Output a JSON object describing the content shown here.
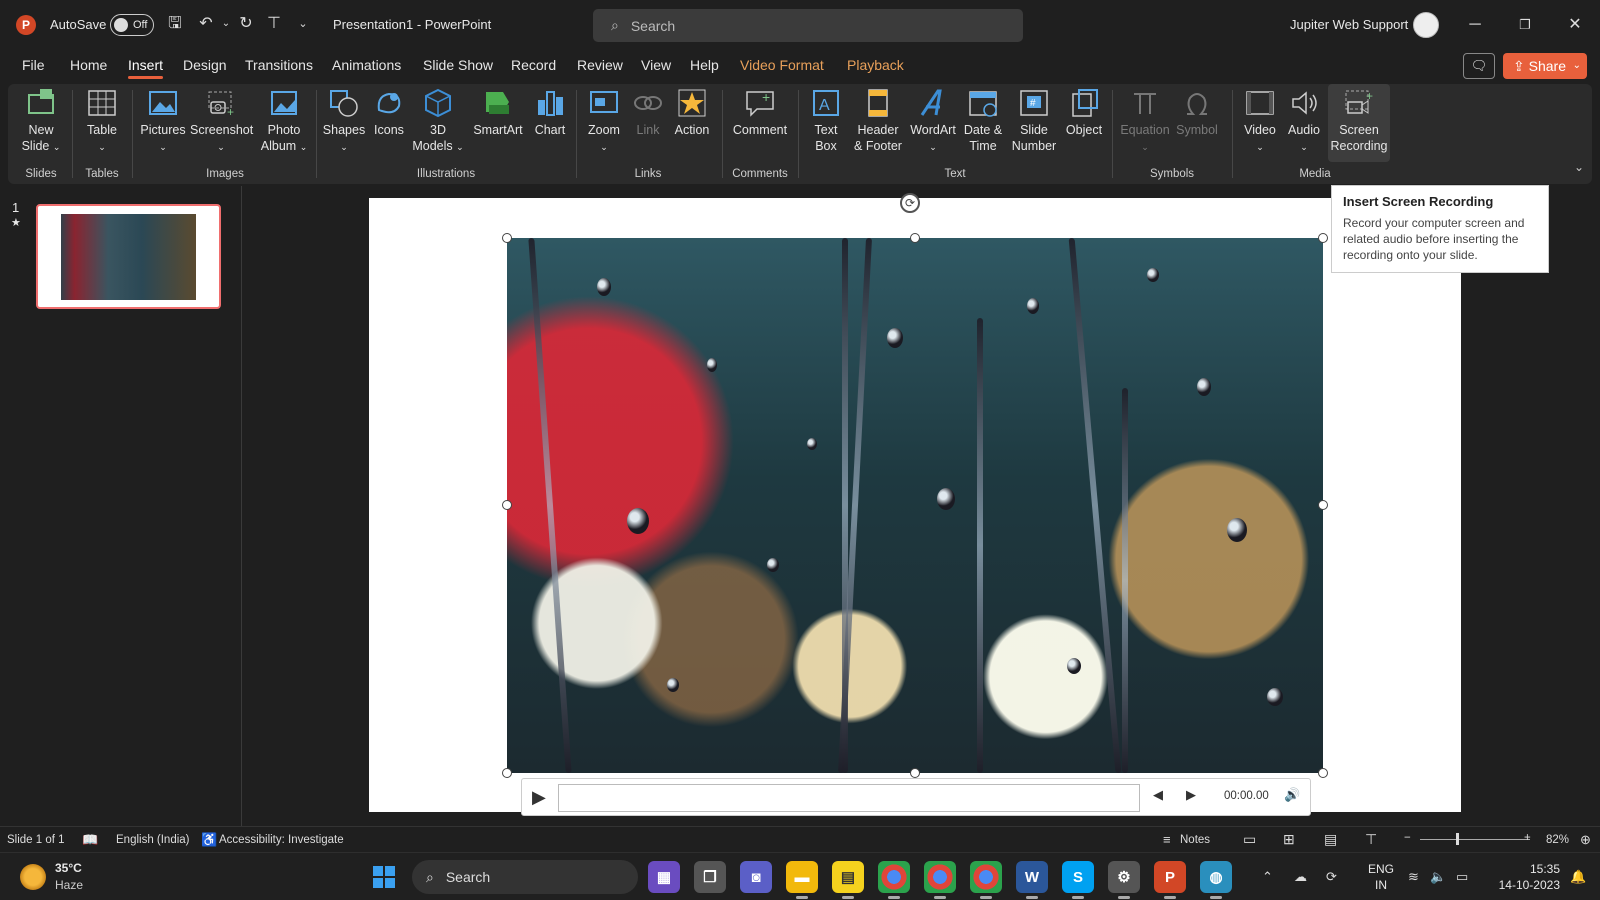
{
  "titlebar": {
    "app_logo": "P",
    "autosave_label": "AutoSave",
    "autosave_state": "Off",
    "doc_title": "Presentation1  -  PowerPoint",
    "search_placeholder": "Search",
    "user_name": "Jupiter Web Support",
    "window_buttons": [
      "minimize-icon",
      "restore-icon",
      "close-icon"
    ]
  },
  "tabs": [
    {
      "label": "File"
    },
    {
      "label": "Home"
    },
    {
      "label": "Insert",
      "active": true
    },
    {
      "label": "Design"
    },
    {
      "label": "Transitions"
    },
    {
      "label": "Animations"
    },
    {
      "label": "Slide Show"
    },
    {
      "label": "Record"
    },
    {
      "label": "Review"
    },
    {
      "label": "View"
    },
    {
      "label": "Help"
    },
    {
      "label": "Video Format",
      "contextual": true
    },
    {
      "label": "Playback",
      "contextual": true
    }
  ],
  "share_label": "Share",
  "ribbon": {
    "groups": {
      "slides": "Slides",
      "tables": "Tables",
      "images": "Images",
      "illustrations": "Illustrations",
      "links": "Links",
      "comments": "Comments",
      "text": "Text",
      "symbols": "Symbols",
      "media": "Media"
    },
    "buttons": {
      "new_slide_1": "New",
      "new_slide_2": "Slide",
      "table": "Table",
      "pictures": "Pictures",
      "screenshot": "Screenshot",
      "photo_album_1": "Photo",
      "photo_album_2": "Album",
      "shapes": "Shapes",
      "icons": "Icons",
      "models_1": "3D",
      "models_2": "Models",
      "smartart": "SmartArt",
      "chart": "Chart",
      "zoom": "Zoom",
      "link": "Link",
      "action": "Action",
      "comment": "Comment",
      "text_box_1": "Text",
      "text_box_2": "Box",
      "header_footer_1": "Header",
      "header_footer_2": "& Footer",
      "wordart": "WordArt",
      "date_time_1": "Date &",
      "date_time_2": "Time",
      "slide_number_1": "Slide",
      "slide_number_2": "Number",
      "object": "Object",
      "equation": "Equation",
      "symbol": "Symbol",
      "video": "Video",
      "audio": "Audio",
      "screen_recording_1": "Screen",
      "screen_recording_2": "Recording"
    }
  },
  "tooltip": {
    "title": "Insert Screen Recording",
    "body": "Record your computer screen and related audio before inserting the recording onto your slide."
  },
  "slide_panel": {
    "number": "1",
    "star": "★"
  },
  "video_controls": {
    "time": "00:00.00"
  },
  "statusbar": {
    "slide_info": "Slide 1 of 1",
    "language": "English (India)",
    "accessibility": "Accessibility: Investigate",
    "notes": "Notes",
    "zoom": "82%",
    "zoom_level": 82
  },
  "taskbar": {
    "weather_temp": "35°C",
    "weather_cond": "Haze",
    "search_label": "Search",
    "lang_1": "ENG",
    "lang_2": "IN",
    "time": "15:35",
    "date": "14-10-2023"
  },
  "colors": {
    "accent": "#e8603c",
    "contextual_tab": "#e8a05a",
    "thumb_border": "#f06e6e"
  }
}
